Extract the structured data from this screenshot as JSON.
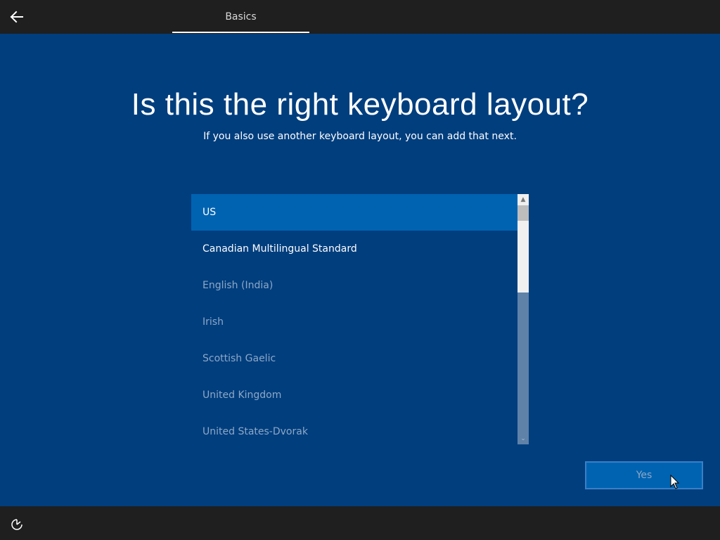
{
  "header": {
    "back_icon": "back-arrow-icon",
    "tab_label": "Basics"
  },
  "main": {
    "title": "Is this the right keyboard layout?",
    "subtitle": "If you also use another keyboard layout, you can add that next."
  },
  "layouts": {
    "items": [
      {
        "label": "US",
        "selected": true
      },
      {
        "label": "Canadian Multilingual Standard",
        "selected": false
      },
      {
        "label": "English (India)",
        "selected": false
      },
      {
        "label": "Irish",
        "selected": false
      },
      {
        "label": "Scottish Gaelic",
        "selected": false
      },
      {
        "label": "United Kingdom",
        "selected": false
      },
      {
        "label": "United States-Dvorak",
        "selected": false
      }
    ]
  },
  "actions": {
    "yes_label": "Yes"
  },
  "footer": {
    "ease_of_access_icon": "ease-of-access-icon"
  },
  "colors": {
    "background": "#003e7e",
    "bars": "#1f1f1f",
    "selection": "#0063b1",
    "dim_text": "#8ea8c6"
  }
}
